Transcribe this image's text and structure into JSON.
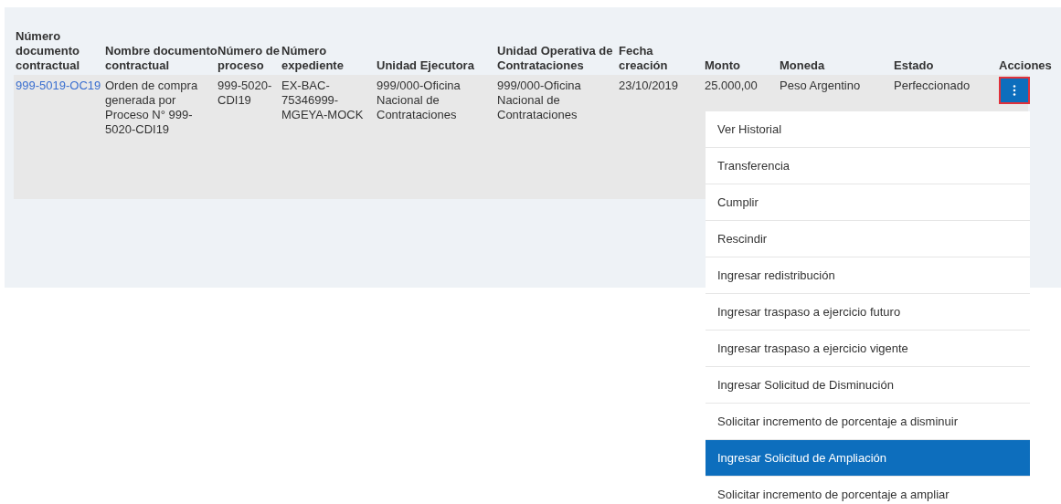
{
  "table": {
    "columns": [
      "Número documento contractual",
      "Nombre documento contractual",
      "Número de proceso",
      "Número expediente",
      "Unidad Ejecutora",
      "Unidad Operativa de Contrataciones",
      "Fecha creación",
      "Monto",
      "Moneda",
      "Estado",
      "Acciones"
    ],
    "rows": [
      {
        "cells": [
          "999-5019-OC19",
          "Orden de compra generada por Proceso N° 999-5020-CDI19",
          "999-5020-CDI19",
          "EX-BAC-75346999-MGEYA-MOCK",
          "999/000-Oficina Nacional de Contrataciones",
          "999/000-Oficina Nacional de Contrataciones",
          "23/10/2019",
          "25.000,00",
          "Peso Argentino",
          "Perfeccionado"
        ],
        "actions_button": {
          "focused": true
        }
      }
    ]
  },
  "actions_menu": {
    "items": [
      {
        "label": "Ver Historial",
        "selected": false
      },
      {
        "label": "Transferencia",
        "selected": false
      },
      {
        "label": "Cumplir",
        "selected": false
      },
      {
        "label": "Rescindir",
        "selected": false
      },
      {
        "label": "Ingresar redistribución",
        "selected": false
      },
      {
        "label": "Ingresar traspaso a ejercicio futuro",
        "selected": false
      },
      {
        "label": "Ingresar traspaso a ejercicio vigente",
        "selected": false
      },
      {
        "label": "Ingresar Solicitud de Disminución",
        "selected": false
      },
      {
        "label": "Solicitar incremento de porcentaje a disminuir",
        "selected": false
      },
      {
        "label": "Ingresar Solicitud de Ampliación",
        "selected": true
      },
      {
        "label": "Solicitar incremento de porcentaje a ampliar",
        "selected": false
      }
    ]
  }
}
